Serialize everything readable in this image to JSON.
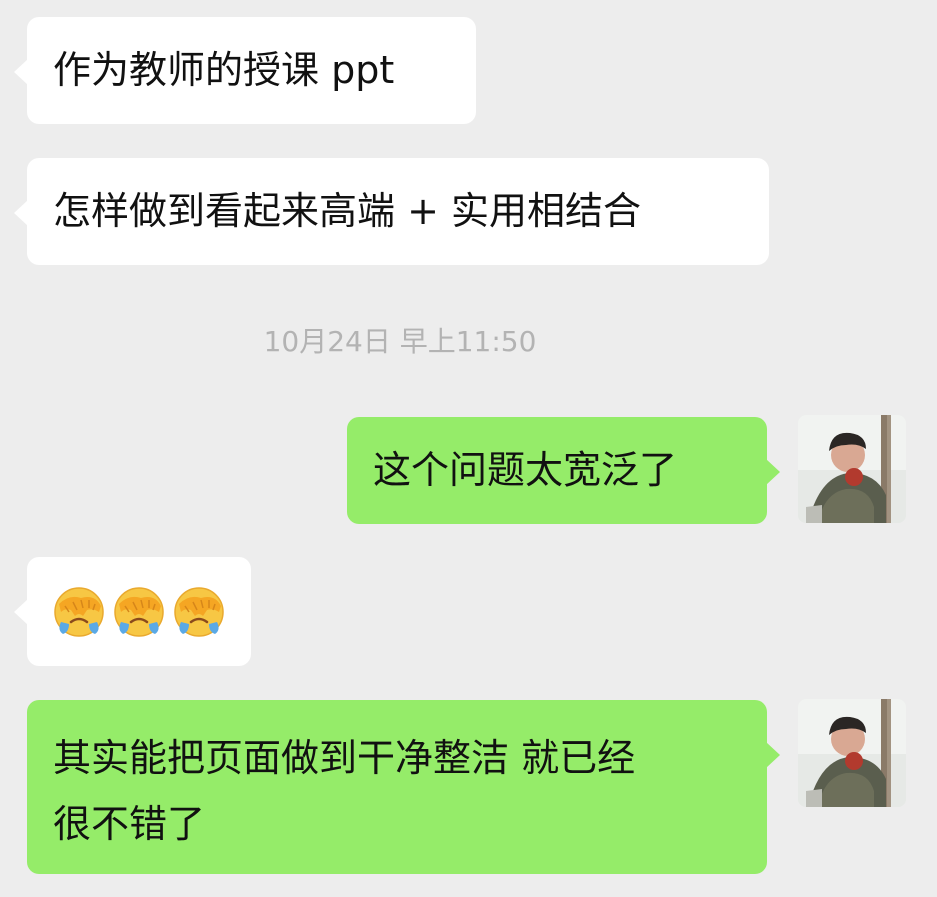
{
  "messages": [
    {
      "side": "left",
      "text": "作为教师的授课 ppt"
    },
    {
      "side": "left",
      "text": "怎样做到看起来高端 + 实用相结合"
    },
    {
      "timestamp": "10月24日 早上11:50"
    },
    {
      "side": "right",
      "text": "这个问题太宽泛了"
    },
    {
      "side": "left",
      "emoji": [
        "face-palm-crying-emoji",
        "face-palm-crying-emoji",
        "face-palm-crying-emoji"
      ]
    },
    {
      "side": "right",
      "line1": "其实能把页面做到干净整洁 就已经",
      "line2": "很不错了"
    }
  ],
  "colors": {
    "background": "#ededed",
    "incoming_bubble": "#ffffff",
    "outgoing_bubble": "#95ec69",
    "timestamp_text": "#b3b3b3"
  }
}
